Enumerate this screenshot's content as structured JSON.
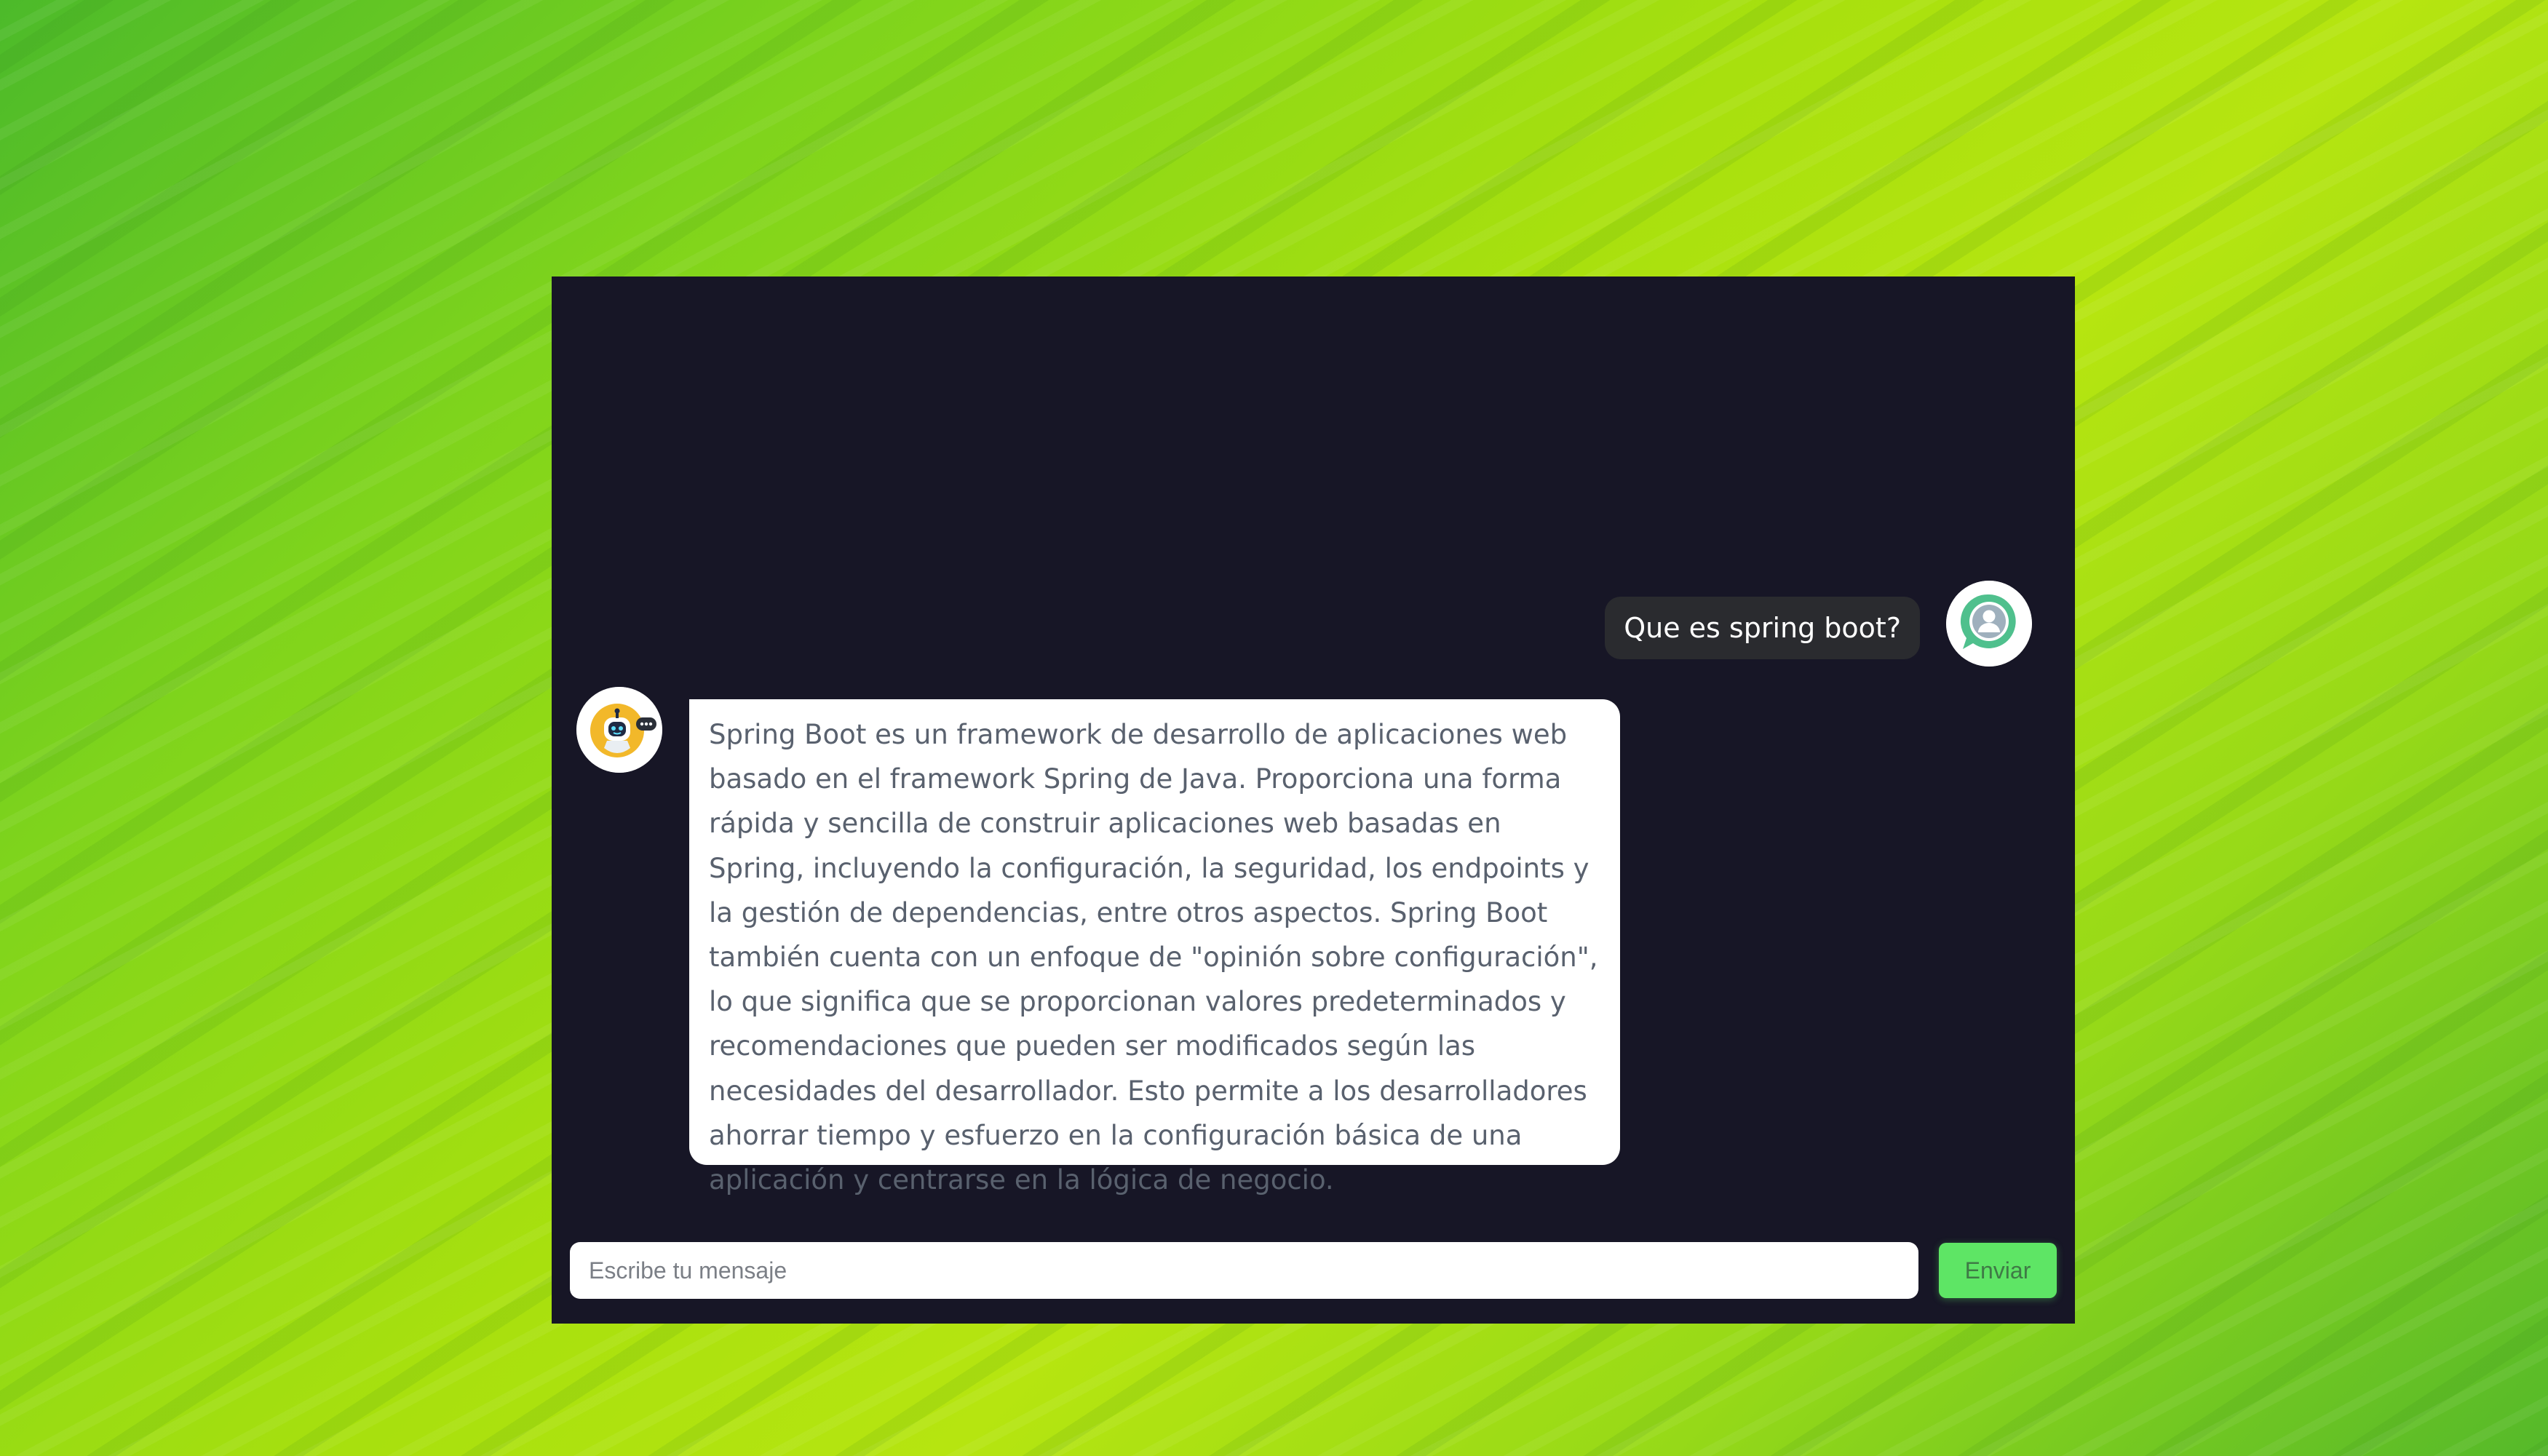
{
  "chat": {
    "messages": [
      {
        "role": "user",
        "text": "Que es spring boot?",
        "avatar_icon": "user-chat-avatar-icon"
      },
      {
        "role": "bot",
        "text": "Spring Boot es un framework de desarrollo de aplicaciones web basado en el framework Spring de Java. Proporciona una forma rápida y sencilla de construir aplicaciones web basadas en Spring, incluyendo la configuración, la seguridad, los endpoints y la gestión de dependencias, entre otros aspectos. Spring Boot también cuenta con un enfoque de \"opinión sobre configuración\", lo que significa que se proporcionan valores predeterminados y recomendaciones que pueden ser modificados según las necesidades del desarrollador. Esto permite a los desarrolladores ahorrar tiempo y esfuerzo en la configuración básica de una aplicación y centrarse en la lógica de negocio.",
        "avatar_icon": "robot-avatar-icon"
      }
    ],
    "input": {
      "placeholder": "Escribe tu mensaje",
      "value": ""
    },
    "send_label": "Enviar"
  },
  "colors": {
    "window_bg": "#171626",
    "user_bubble_bg": "#2a2b2f",
    "bot_bubble_bg": "#ffffff",
    "bot_text": "#59616e",
    "send_button_bg": "#5ee565",
    "send_button_text": "#3f7a46"
  }
}
